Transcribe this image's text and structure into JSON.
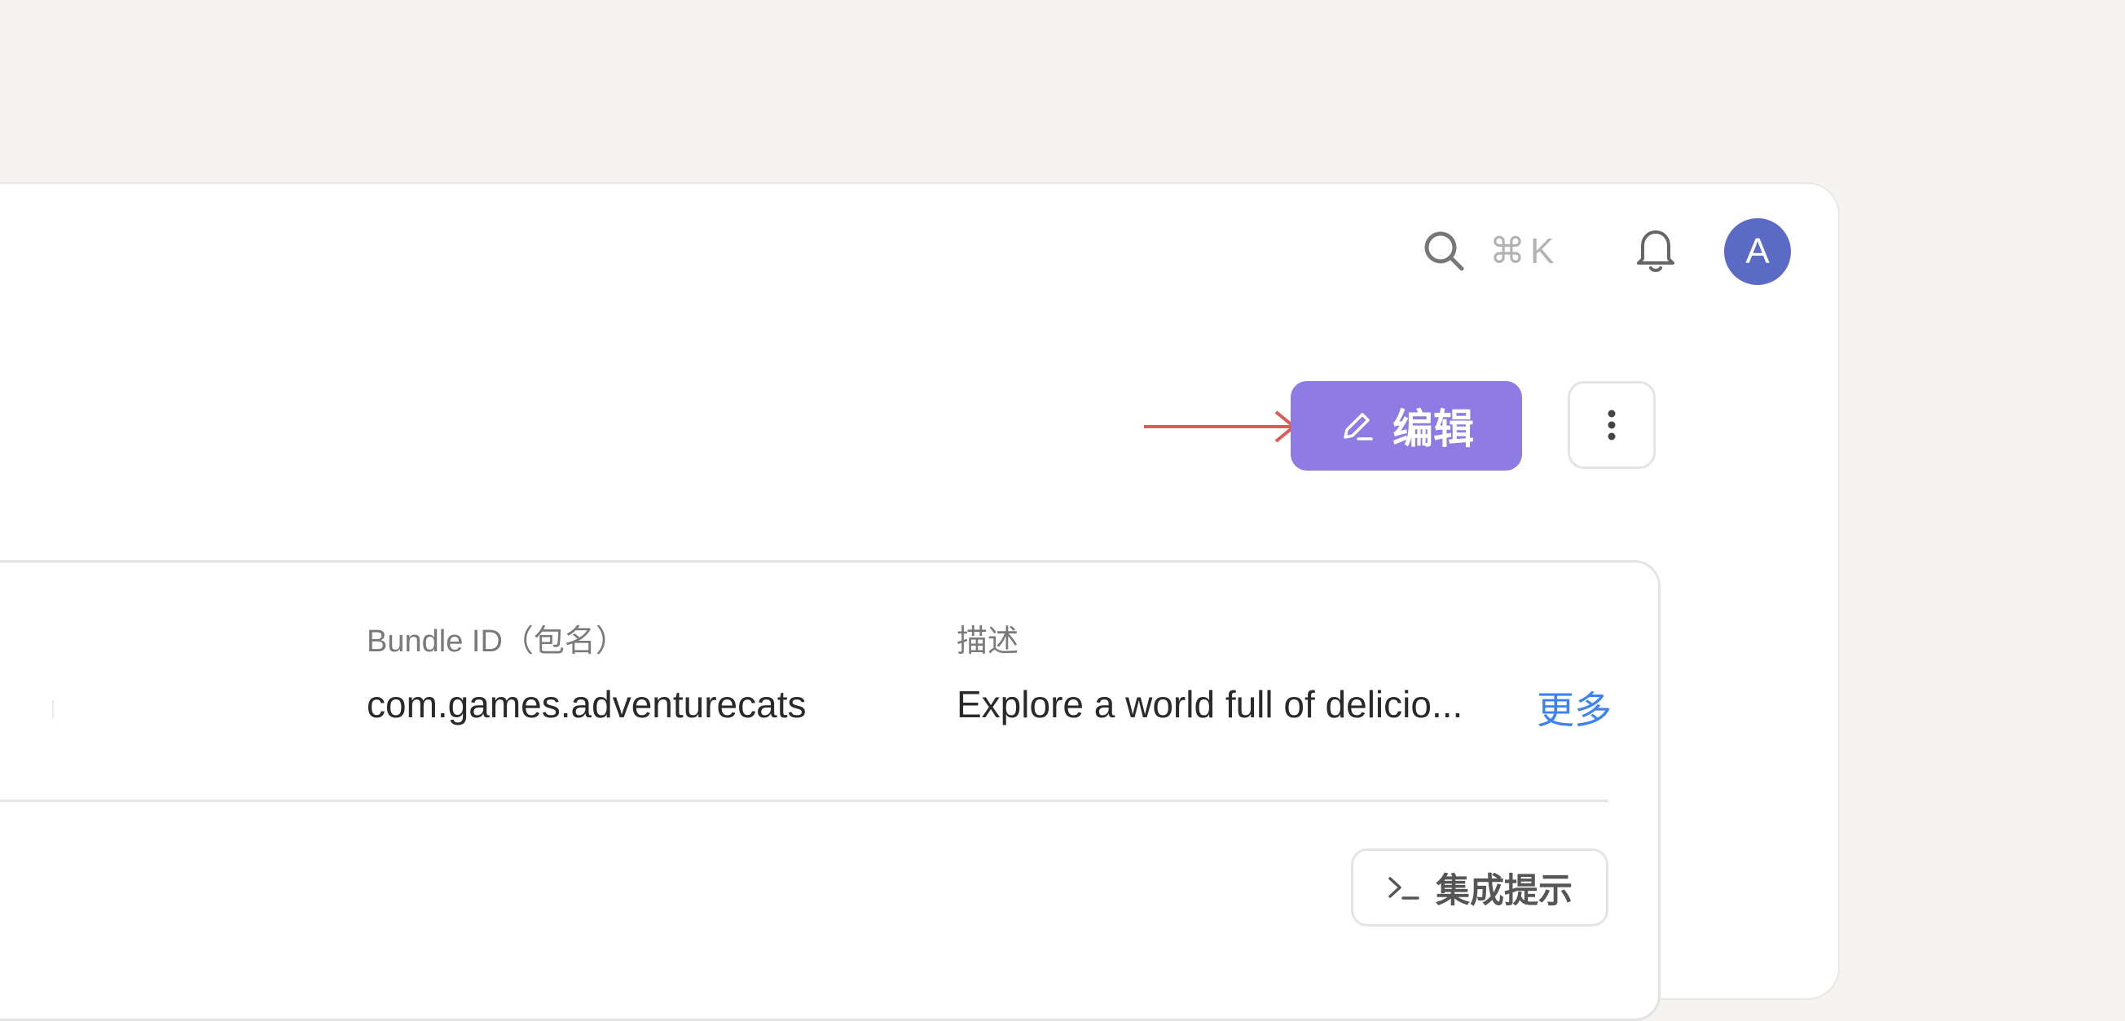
{
  "topbar": {
    "search_shortcut": "⌘K",
    "avatar_initial": "A"
  },
  "toolbar": {
    "edit_label": "编辑",
    "more_options_icon": "vertical-dots-icon"
  },
  "details": {
    "bundle_id": {
      "label": "Bundle ID（包名）",
      "value": "com.games.adventurecats"
    },
    "description": {
      "label": "描述",
      "value": "Explore a world full of delicio...",
      "more_link": "更多"
    }
  },
  "actions": {
    "integration_hint_label": "集成提示"
  },
  "colors": {
    "accent": "#8e7be3",
    "avatar": "#5b6bc5",
    "link": "#3b82f6",
    "arrow": "#e05a5a"
  }
}
